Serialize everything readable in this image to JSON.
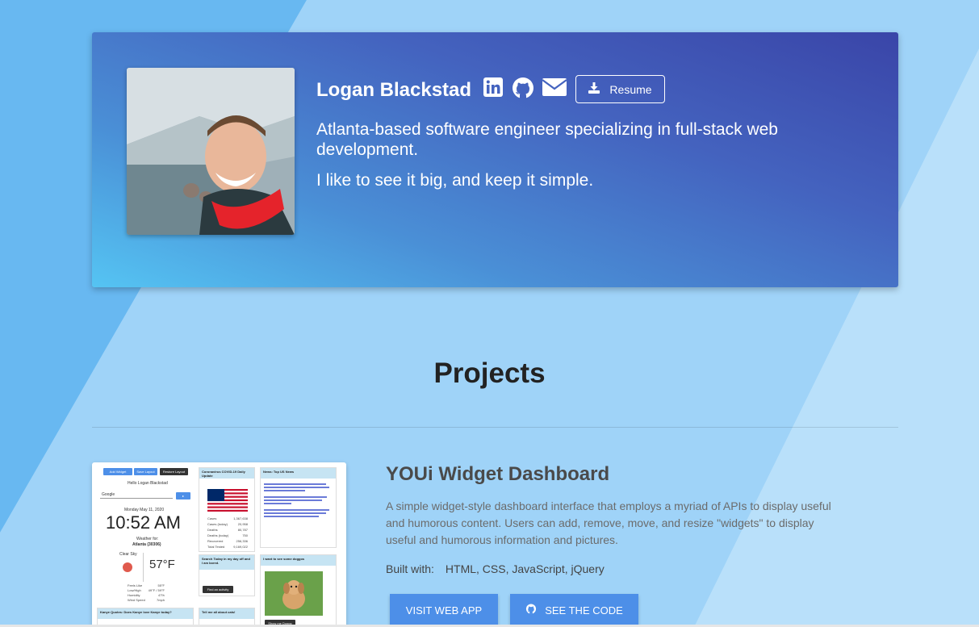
{
  "colors": {
    "page_background": "#a7d6f7",
    "hero_gradient_start": "#3a45a8",
    "hero_gradient_end": "#55c4f3",
    "button_blue": "#4d8fe8"
  },
  "hero": {
    "name": "Logan Blackstad",
    "social_icons": [
      "linkedin-icon",
      "github-icon",
      "envelope-icon"
    ],
    "resume_label": "Resume",
    "tagline": "Atlanta-based software engineer specializing in full-stack web development.",
    "motto": "I like to see it big, and keep it simple."
  },
  "projects": {
    "heading": "Projects",
    "items": [
      {
        "title": "YOUi Widget Dashboard",
        "description": "A simple widget-style dashboard interface that employs a myriad of APIs to display useful and humorous content. Users can add, remove, move, and resize \"widgets\" to display useful and humorous information and pictures.",
        "built_with_label": "Built with:",
        "technologies": "HTML, CSS, JavaScript, jQuery",
        "visit_label": "VISIT WEB APP",
        "code_label": "SEE THE CODE",
        "screenshot": {
          "add_widget": "Add Widget",
          "save_layout": "Save Layout",
          "restore_layout": "Restore Layout",
          "greeting": "Hello Logan Blackstad",
          "search_placeholder": "Google",
          "date": "Monday May 11, 2020",
          "time": "10:52 AM",
          "location_label": "Weather for:",
          "location": "Atlanta (30306)",
          "sky": "Clear Sky",
          "temp": "57°F",
          "covid_title": "Coronavirus COVID-19 Daily Update",
          "news_title": "News: Top US News",
          "search_title": "Search Today in my day off and I am bored.",
          "find_activity": "Find an activity",
          "doggo_title": "I want to see some doggos",
          "kanye_title": "Kanye Quotes: Does Kanye love Kanye today?",
          "tell_me": "Tell me all about cats!",
          "covid_rows": [
            [
              "Cases",
              "1,367,638"
            ],
            [
              "Cases (today)",
              "20,958"
            ],
            [
              "Deaths",
              "80,787"
            ],
            [
              "Deaths (today)",
              "750"
            ],
            [
              "Recovered",
              "256,336"
            ],
            [
              "Total Tested",
              "9,169,022"
            ]
          ],
          "weather_rows": [
            [
              "Feels Like",
              "55°F"
            ],
            [
              "Low/High",
              "49°F / 59°F"
            ],
            [
              "Humidity",
              "47%"
            ],
            [
              "Wind Speed",
              "7mph"
            ]
          ]
        }
      }
    ]
  }
}
